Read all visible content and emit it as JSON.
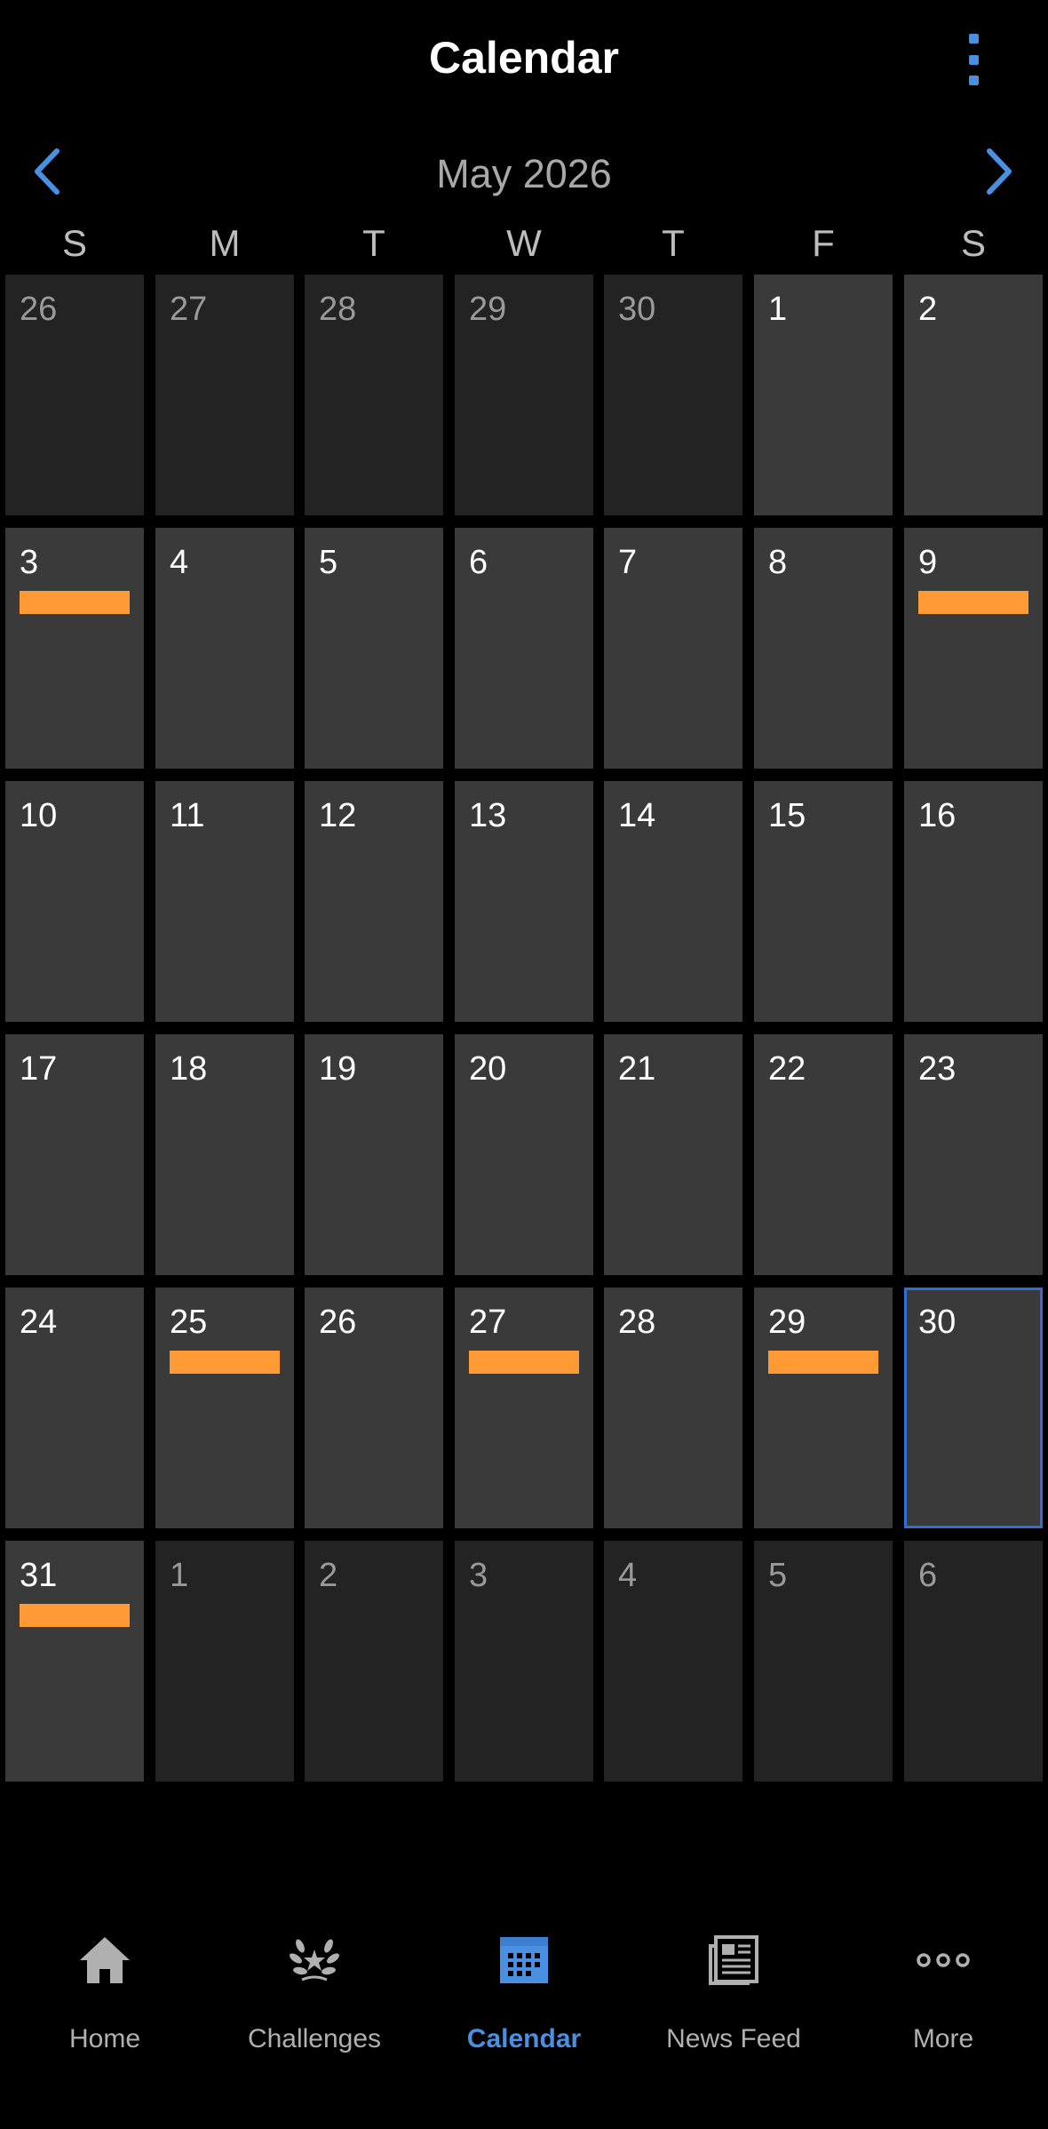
{
  "header": {
    "title": "Calendar"
  },
  "month_bar": {
    "label": "May 2026"
  },
  "weekdays": [
    "S",
    "M",
    "T",
    "W",
    "T",
    "F",
    "S"
  ],
  "weeks": [
    [
      {
        "day": "26",
        "in_month": false,
        "event": false
      },
      {
        "day": "27",
        "in_month": false,
        "event": false
      },
      {
        "day": "28",
        "in_month": false,
        "event": false
      },
      {
        "day": "29",
        "in_month": false,
        "event": false
      },
      {
        "day": "30",
        "in_month": false,
        "event": false
      },
      {
        "day": "1",
        "in_month": true,
        "event": false
      },
      {
        "day": "2",
        "in_month": true,
        "event": false
      }
    ],
    [
      {
        "day": "3",
        "in_month": true,
        "event": true
      },
      {
        "day": "4",
        "in_month": true,
        "event": false
      },
      {
        "day": "5",
        "in_month": true,
        "event": false
      },
      {
        "day": "6",
        "in_month": true,
        "event": false
      },
      {
        "day": "7",
        "in_month": true,
        "event": false
      },
      {
        "day": "8",
        "in_month": true,
        "event": false
      },
      {
        "day": "9",
        "in_month": true,
        "event": true
      }
    ],
    [
      {
        "day": "10",
        "in_month": true,
        "event": false
      },
      {
        "day": "11",
        "in_month": true,
        "event": false
      },
      {
        "day": "12",
        "in_month": true,
        "event": false
      },
      {
        "day": "13",
        "in_month": true,
        "event": false
      },
      {
        "day": "14",
        "in_month": true,
        "event": false
      },
      {
        "day": "15",
        "in_month": true,
        "event": false
      },
      {
        "day": "16",
        "in_month": true,
        "event": false
      }
    ],
    [
      {
        "day": "17",
        "in_month": true,
        "event": false
      },
      {
        "day": "18",
        "in_month": true,
        "event": false
      },
      {
        "day": "19",
        "in_month": true,
        "event": false
      },
      {
        "day": "20",
        "in_month": true,
        "event": false
      },
      {
        "day": "21",
        "in_month": true,
        "event": false
      },
      {
        "day": "22",
        "in_month": true,
        "event": false
      },
      {
        "day": "23",
        "in_month": true,
        "event": false
      }
    ],
    [
      {
        "day": "24",
        "in_month": true,
        "event": false
      },
      {
        "day": "25",
        "in_month": true,
        "event": true
      },
      {
        "day": "26",
        "in_month": true,
        "event": false
      },
      {
        "day": "27",
        "in_month": true,
        "event": true
      },
      {
        "day": "28",
        "in_month": true,
        "event": false
      },
      {
        "day": "29",
        "in_month": true,
        "event": true
      },
      {
        "day": "30",
        "in_month": true,
        "event": false,
        "today": true
      }
    ],
    [
      {
        "day": "31",
        "in_month": true,
        "event": true
      },
      {
        "day": "1",
        "in_month": false,
        "event": false
      },
      {
        "day": "2",
        "in_month": false,
        "event": false
      },
      {
        "day": "3",
        "in_month": false,
        "event": false
      },
      {
        "day": "4",
        "in_month": false,
        "event": false
      },
      {
        "day": "5",
        "in_month": false,
        "event": false
      },
      {
        "day": "6",
        "in_month": false,
        "event": false
      }
    ]
  ],
  "tabbar": {
    "items": [
      {
        "label": "Home",
        "icon": "home-icon",
        "active": false
      },
      {
        "label": "Challenges",
        "icon": "laurel-icon",
        "active": false
      },
      {
        "label": "Calendar",
        "icon": "calendar-icon",
        "active": true
      },
      {
        "label": "News Feed",
        "icon": "newspaper-icon",
        "active": false
      },
      {
        "label": "More",
        "icon": "more-dots-icon",
        "active": false
      }
    ]
  },
  "colors": {
    "accent": "#4a90e2",
    "event": "#ff9a35",
    "today_border": "#2f6fd1",
    "cell_in_month": "#3a3a3a",
    "cell_other_month": "#232323"
  }
}
